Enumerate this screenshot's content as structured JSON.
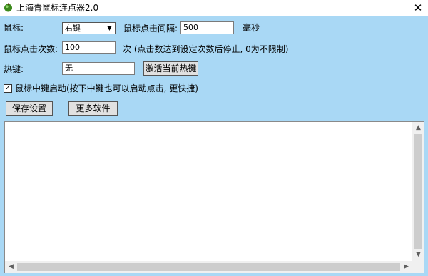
{
  "window": {
    "title": "上海青鼠标连点器2.0",
    "close_symbol": "✕"
  },
  "settings": {
    "mouse_label": "鼠标:",
    "mouse_button_value": "右键",
    "interval_label": "鼠标点击间隔:",
    "interval_value": "500",
    "interval_unit": "毫秒",
    "count_label": "鼠标点击次数:",
    "count_value": "100",
    "count_note": "次 (点击数达到设定次数后停止, 0为不限制)",
    "hotkey_label": "热键:",
    "hotkey_value": "无",
    "activate_hotkey_label": "激活当前热键",
    "middle_start_label": "鼠标中键启动",
    "middle_start_checked": true,
    "middle_start_note": "(按下中键也可以启动点击, 更快捷)"
  },
  "buttons": {
    "save_label": "保存设置",
    "more_software_label": "更多软件"
  },
  "icons": {
    "app": "green-ball-icon",
    "dropdown": "chevron-down-icon",
    "check": "checkmark-icon",
    "scroll_up": "triangle-up-icon",
    "scroll_down": "triangle-down-icon",
    "scroll_left": "triangle-left-icon",
    "scroll_right": "triangle-right-icon"
  },
  "colors": {
    "client_background": "#a9d8f5",
    "button_face": "#e1e1e1",
    "icon_green": "#3d8a1c"
  }
}
